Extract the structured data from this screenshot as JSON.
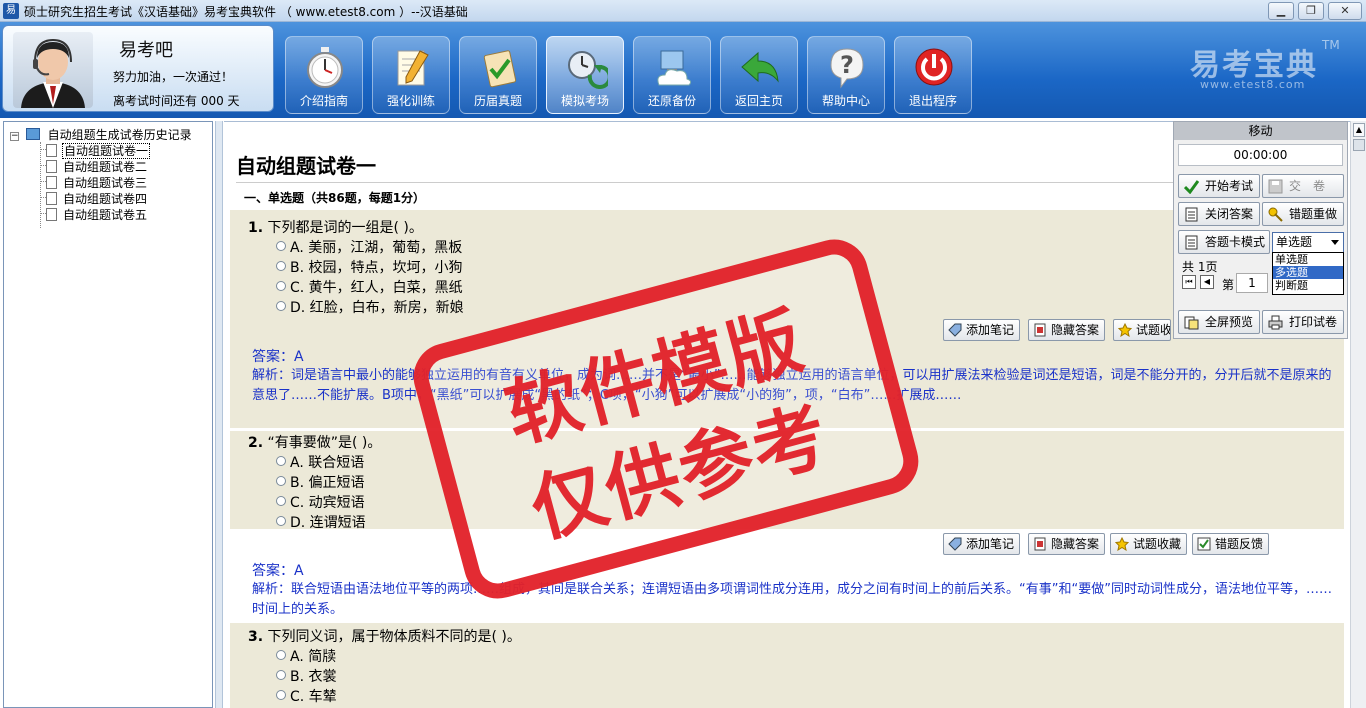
{
  "window": {
    "title": "硕士研究生招生考试《汉语基础》易考宝典软件 （ www.etest8.com ）--汉语基础",
    "icon_text": "易"
  },
  "profile": {
    "name": "易考吧",
    "motto": "努力加油，一次通过！",
    "countdown": "离考试时间还有 000 天"
  },
  "nav": [
    {
      "label": "介绍指南",
      "icon": "stopwatch-icon"
    },
    {
      "label": "强化训练",
      "icon": "pencil-note-icon"
    },
    {
      "label": "历届真题",
      "icon": "checklist-icon"
    },
    {
      "label": "模拟考场",
      "icon": "clock-refresh-icon",
      "active": true
    },
    {
      "label": "还原备份",
      "icon": "cloud-computer-icon"
    },
    {
      "label": "返回主页",
      "icon": "back-arrow-icon"
    },
    {
      "label": "帮助中心",
      "icon": "question-icon"
    },
    {
      "label": "退出程序",
      "icon": "power-icon"
    }
  ],
  "brand": {
    "name": "易考宝典",
    "tm": "TM",
    "url": "www.etest8.com"
  },
  "tree": {
    "root": "自动组题生成试卷历史记录",
    "items": [
      "自动组题试卷一",
      "自动组题试卷二",
      "自动组题试卷三",
      "自动组题试卷四",
      "自动组题试卷五"
    ],
    "selected_index": 0
  },
  "paper": {
    "title": "自动组题试卷一",
    "section": "一、单选题（共86题，每题1分）"
  },
  "questions": [
    {
      "number": "1.",
      "text": "下列都是词的一组是(  )。",
      "options": [
        "A. 美丽，江湖，葡萄，黑板",
        "B. 校园，特点，坎坷，小狗",
        "C. 黄牛，红人，白菜，黑纸",
        "D. 红脸，白布，新房，新娘"
      ],
      "answer": "答案：A",
      "explanation": "解析：词是语言中最小的能够独立运用的有音有义单位，成为词……并不是“最小”……能够独立运用的语言单位，可以用扩展法来检验是词还是短语，词是不能分开的，分开后就不是原来的意思了……不能扩展。B项中，“黑纸”可以扩展成“黑的纸”；C项，“小狗”可以扩展成“小的狗”，项，“白布”……扩展成……"
    },
    {
      "number": "2.",
      "text": "“有事要做”是(  )。",
      "options": [
        "A. 联合短语",
        "B. 偏正短语",
        "C. 动宾短语",
        "D. 连谓短语"
      ],
      "answer": "答案：A",
      "explanation": "解析：联合短语由语法地位平等的两项……组成，其间是联合关系；连谓短语由多项谓词性成分连用，成分之间有时间上的前后关系。“有事”和“要做”同时动词性成分，语法地位平等，……时间上的关系。"
    },
    {
      "number": "3.",
      "text": "下列同义词，属于物体质料不同的是(  )。",
      "options": [
        "A. 简牍",
        "B. 衣裳",
        "C. 车辇"
      ]
    }
  ],
  "question_buttons": [
    "添加笔记",
    "隐藏答案",
    "试题收藏",
    "错题反馈"
  ],
  "exam_panel": {
    "header": "移动",
    "timer": "00:00:00",
    "start": "开始考试",
    "submit": "交　卷",
    "close_answers": "关闭答案",
    "redo_wrong": "错题重做",
    "card_mode": "答题卡模式",
    "mode_selected": "单选题",
    "mode_options": [
      "单选题",
      "多选题",
      "判断题"
    ],
    "mode_highlight": 1,
    "pages_total": "共 1页",
    "page_prefix": "第",
    "page_current": "1",
    "fullscreen": "全屏预览",
    "print": "打印试卷"
  },
  "watermark": {
    "line1": "软件模版",
    "line2": "仅供参考"
  },
  "colors": {
    "header_blue": "#1b67c6",
    "answer_blue": "#1a32c8",
    "stamp_red": "#e2232b",
    "question_bg": "#ece9d8"
  }
}
